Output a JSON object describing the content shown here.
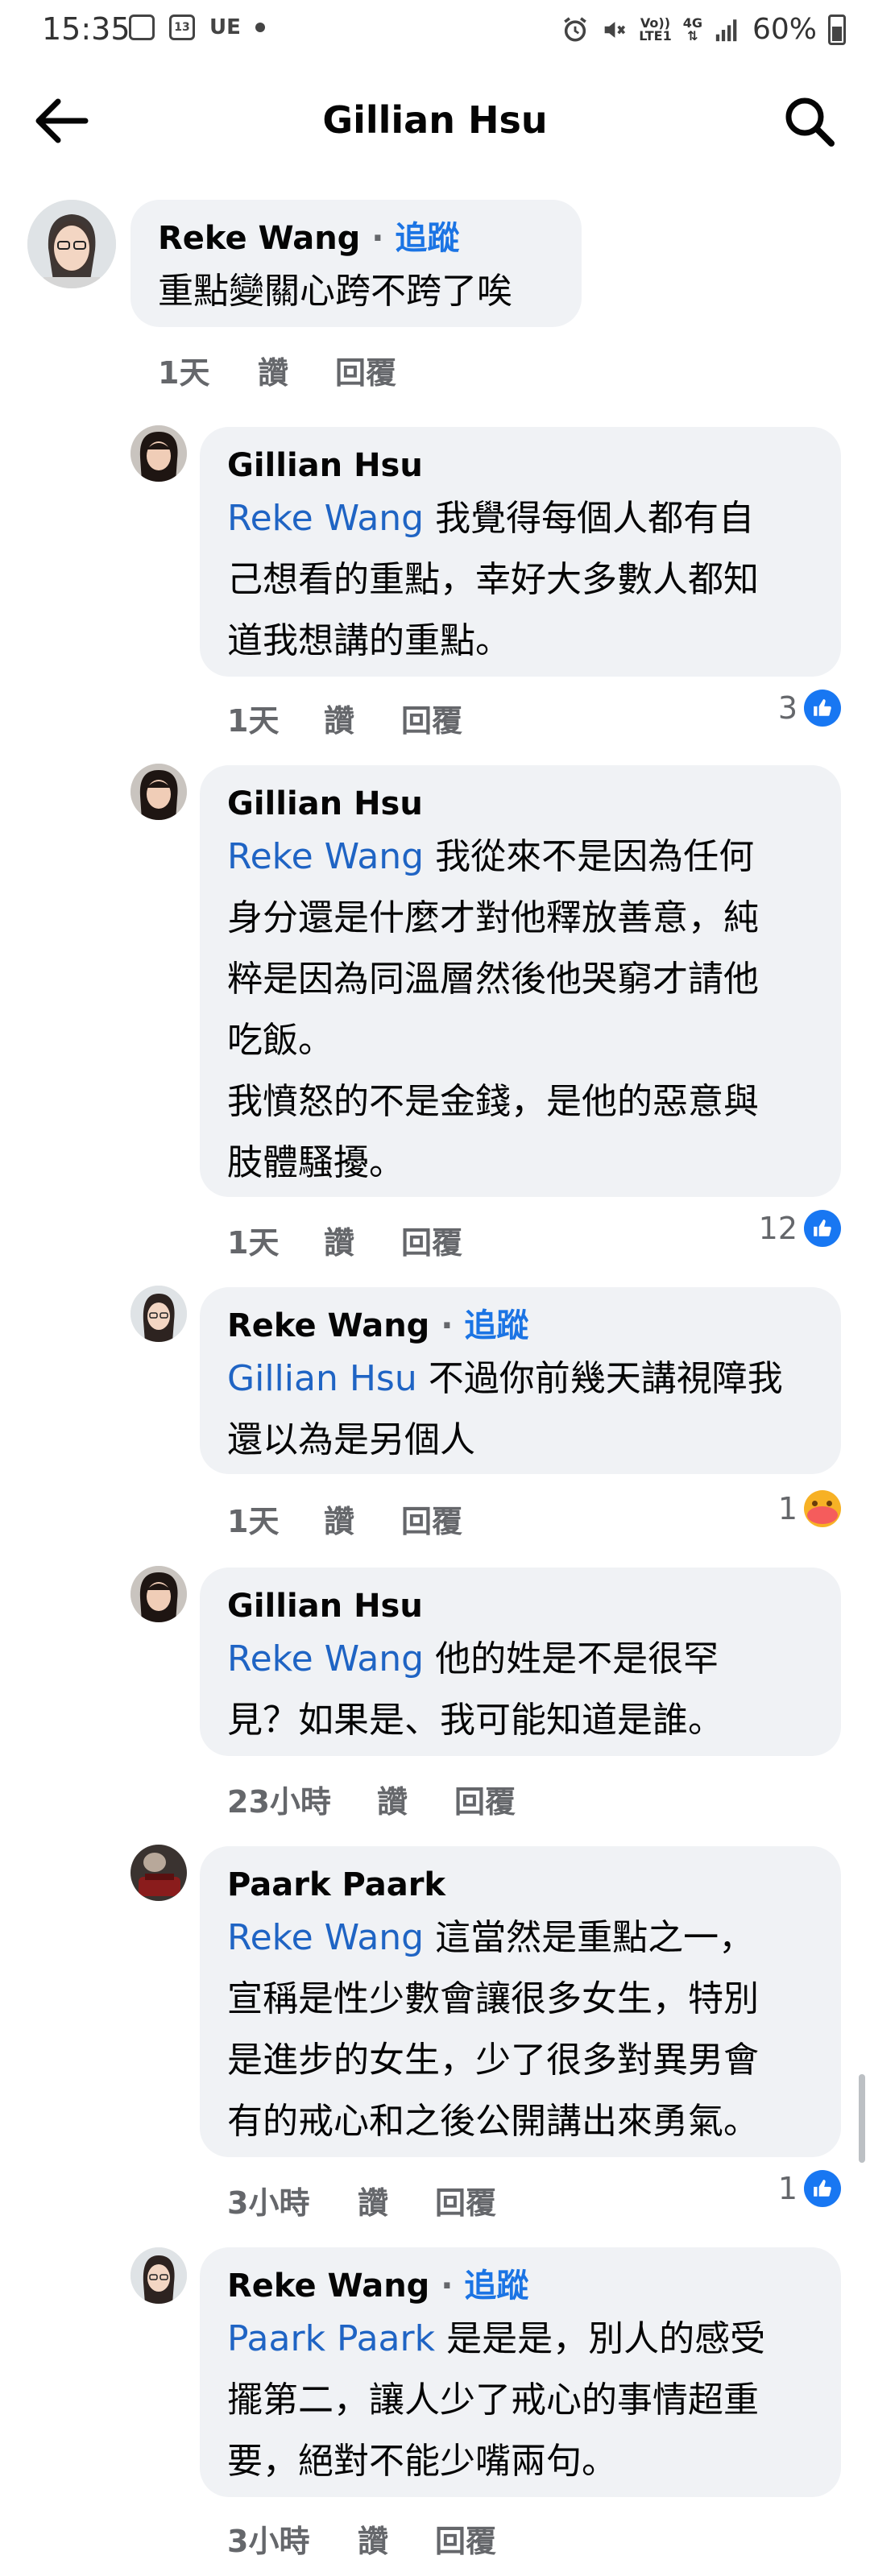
{
  "status": {
    "time": "15:35",
    "badge": "13",
    "carrier": "UE",
    "volte_top": "Vo))",
    "volte_bottom": "LTE1",
    "net": "4G",
    "battery": "60%"
  },
  "header": {
    "title": "Gillian Hsu"
  },
  "labels": {
    "follow": "追蹤",
    "like": "讚",
    "reply": "回覆",
    "sep": "·"
  },
  "comments": [
    {
      "author": "Reke Wang",
      "follow": true,
      "text": "重點變關心跨不跨了唉",
      "time": "1天"
    },
    {
      "author": "Gillian Hsu",
      "mention": "Reke Wang",
      "text": " 我覺得每個人都有自\n己想看的重點，幸好大多數人都知\n道我想講的重點。",
      "time": "1天",
      "reactions": "3"
    },
    {
      "author": "Gillian Hsu",
      "mention": "Reke Wang",
      "text": " 我從來不是因為任何\n身分還是什麼才對他釋放善意，純\n粹是因為同溫層然後他哭窮才請他\n吃飯。\n我憤怒的不是金錢，是他的惡意與\n肢體騷擾。",
      "time": "1天",
      "reactions": "12"
    },
    {
      "author": "Reke Wang",
      "follow": true,
      "mention": "Gillian Hsu",
      "text": " 不過你前幾天講視障我\n還以為是另個人",
      "time": "1天",
      "reactions": "1"
    },
    {
      "author": "Gillian Hsu",
      "mention": "Reke Wang",
      "text": " 他的姓是不是很罕\n見？如果是、我可能知道是誰。",
      "time": "23小時"
    },
    {
      "author": "Paark Paark",
      "mention": "Reke Wang",
      "text": " 這當然是重點之一，\n宣稱是性少數會讓很多女生，特別\n是進步的女生，少了很多對異男會\n有的戒心和之後公開講出來勇氣。",
      "time": "3小時",
      "reactions": "1"
    },
    {
      "author": "Reke Wang",
      "follow": true,
      "mention": "Paark Paark",
      "text": " 是是是，別人的感受\n擺第二，讓人少了戒心的事情超重\n要，絕對不能少嘴兩句。",
      "time": "3小時"
    }
  ]
}
